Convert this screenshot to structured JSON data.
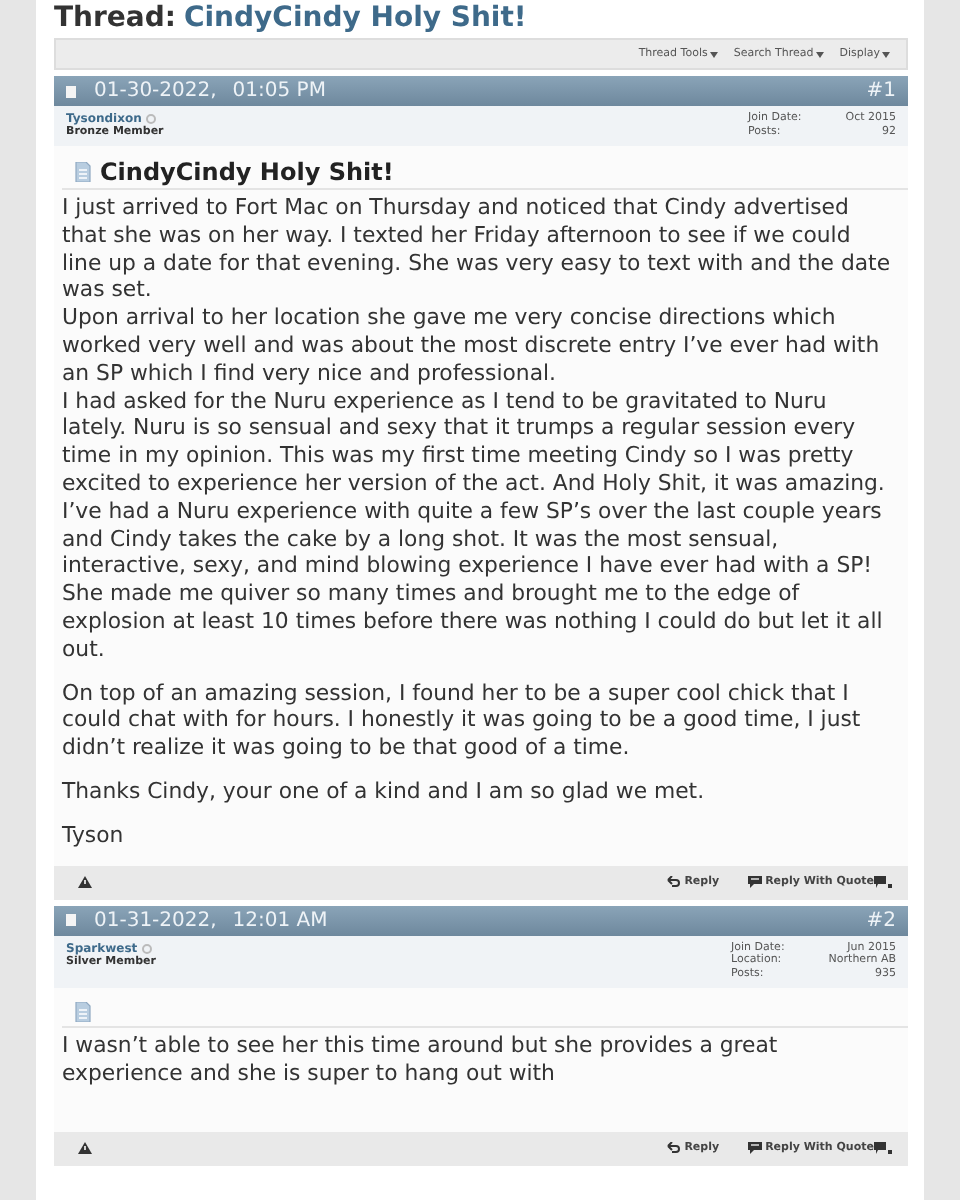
{
  "thread": {
    "label": "Thread:",
    "title": "CindyCindy Holy Shit!"
  },
  "toolbar": [
    "Thread Tools",
    "Search Thread",
    "Display"
  ],
  "posts": [
    {
      "date": "01-30-2022,",
      "time": "01:05 PM",
      "number": "#1",
      "user": "Tysondixon",
      "online": false,
      "rank": "Bronze Member",
      "info": [
        {
          "label": "Join Date:",
          "value": "Oct 2015"
        },
        {
          "label": "Posts:",
          "value": "92"
        }
      ],
      "title": "CindyCindy Holy Shit!",
      "blocks": [
        [
          "I just arrived to Fort Mac on Thursday and noticed that Cindy advertised that she was on her way. I texted her Friday afternoon to see if we could line up a date for that evening. She was very easy to text with and the date was set.",
          "Upon arrival to her location she gave me very concise directions which worked very well and was about the most discrete entry I’ve ever had with an SP which I find very nice and professional.",
          "I had asked for the Nuru experience as I tend to be gravitated to Nuru lately. Nuru is so sensual and sexy that it trumps a regular session every time in my opinion. This was my first time meeting Cindy so I was pretty excited to experience her version of the act. And Holy Shit, it was amazing. I’ve had a Nuru experience with quite a few SP’s over the last couple years and Cindy takes the cake by a long shot. It was the most sensual, interactive, sexy, and mind blowing experience I have ever had with a SP! She made me quiver so many times and brought me to the edge of explosion at least 10 times before there was nothing I could do but let it all out."
        ],
        [
          "On top of an amazing session, I found her to be a super cool chick that I could chat with for hours. I honestly it was going to be a good time, I just didn’t realize it was going to be that good of a time."
        ],
        [
          "Thanks Cindy, your one of a kind and I am so glad we met."
        ],
        [
          "Tyson"
        ]
      ],
      "actions": [
        "Reply",
        "Reply With Quote"
      ]
    },
    {
      "date": "01-31-2022,",
      "time": "12:01 AM",
      "number": "#2",
      "user": "Sparkwest",
      "online": false,
      "rank": "Silver Member",
      "info": [
        {
          "label": "Join Date:",
          "value": "Jun 2015"
        },
        {
          "label": "Location:",
          "value": "Northern AB"
        },
        {
          "label": "Posts:",
          "value": "935"
        }
      ],
      "blocks": [
        [
          "I wasn’t able to see her this time around but she provides a great experience and she is super to hang out with"
        ]
      ],
      "actions": [
        "Reply",
        "Reply With Quote"
      ]
    }
  ]
}
